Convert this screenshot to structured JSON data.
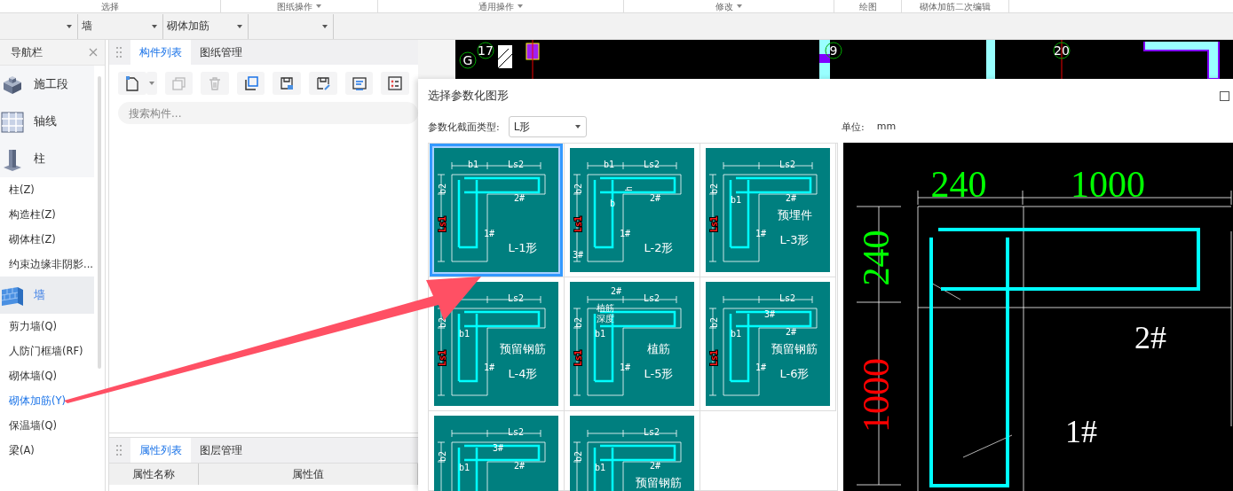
{
  "ribbon_groups": [
    {
      "label": "选择",
      "dropdown": false
    },
    {
      "label": "图纸操作",
      "dropdown": true
    },
    {
      "label": "通用操作",
      "dropdown": true
    },
    {
      "label": "修改",
      "dropdown": true
    },
    {
      "label": "绘图",
      "dropdown": false
    },
    {
      "label": "砌体加筋二次编辑",
      "dropdown": false
    }
  ],
  "toolbar_selects": [
    {
      "kind": "select"
    },
    {
      "kind": "select",
      "value": "墙"
    },
    {
      "kind": "select",
      "value": "砌体加筋"
    },
    {
      "kind": "select"
    }
  ],
  "nav": {
    "title": "导航栏",
    "items": [
      {
        "kind": "category",
        "label": "施工段",
        "selected": false
      },
      {
        "kind": "category",
        "label": "轴线",
        "selected": false
      },
      {
        "kind": "category",
        "label": "柱",
        "selected": false
      },
      {
        "kind": "item",
        "label": "柱(Z)",
        "selected": false
      },
      {
        "kind": "item",
        "label": "构造柱(Z)",
        "selected": false
      },
      {
        "kind": "item",
        "label": "砌体柱(Z)",
        "selected": false
      },
      {
        "kind": "item",
        "label": "约束边缘非阴影...",
        "selected": false
      },
      {
        "kind": "category",
        "label": "墙",
        "selected": true
      },
      {
        "kind": "item",
        "label": "剪力墙(Q)",
        "selected": false
      },
      {
        "kind": "item",
        "label": "人防门框墙(RF)",
        "selected": false
      },
      {
        "kind": "item",
        "label": "砌体墙(Q)",
        "selected": false
      },
      {
        "kind": "item",
        "label": "砌体加筋(Y)",
        "selected": true
      },
      {
        "kind": "item",
        "label": "保温墙(Q)",
        "selected": false
      },
      {
        "kind": "item",
        "label": "梁(A)",
        "selected": false
      }
    ]
  },
  "component_panel": {
    "tabs": [
      {
        "label": "构件列表",
        "selected": true
      },
      {
        "label": "图纸管理",
        "selected": false
      }
    ],
    "tools": [
      {
        "kind": "new",
        "disabled": false
      },
      {
        "kind": "copy",
        "disabled": true
      },
      {
        "kind": "delete",
        "disabled": true
      },
      {
        "kind": "layers",
        "disabled": false
      },
      {
        "kind": "save",
        "disabled": false
      },
      {
        "kind": "edit",
        "disabled": false
      },
      {
        "kind": "text",
        "disabled": false
      },
      {
        "kind": "list",
        "disabled": false
      }
    ],
    "search": {
      "placeholder": "搜索构件..."
    }
  },
  "property_panel": {
    "tabs": [
      {
        "label": "属性列表",
        "selected": true
      },
      {
        "label": "图层管理",
        "selected": false
      }
    ],
    "columns": [
      "属性名称",
      "属性值"
    ]
  },
  "cad": {
    "axes": [
      {
        "label": "G"
      },
      {
        "label": "17"
      },
      {
        "label": "9"
      },
      {
        "label": "20"
      }
    ]
  },
  "dialog": {
    "title": "选择参数化图形",
    "type_label": "参数化截面类型:",
    "type_value": "L形",
    "unit_label": "单位:",
    "unit": "mm",
    "shapes": [
      {
        "kind": "plain",
        "selected": true,
        "labels": [
          {
            "kind": "b1",
            "text": "b1"
          },
          {
            "kind": "ls2",
            "text": "Ls2"
          },
          {
            "kind": "b2",
            "text": "b2"
          },
          {
            "kind": "ls1",
            "text": "Ls1"
          },
          {
            "kind": "bar2",
            "text": "2#"
          },
          {
            "kind": "bar1",
            "text": "1#"
          }
        ],
        "caption": [
          "L-1形"
        ]
      },
      {
        "kind": "plain",
        "selected": false,
        "labels": [
          {
            "kind": "b1",
            "text": "b1"
          },
          {
            "kind": "ls2",
            "text": "Ls2"
          },
          {
            "kind": "b2",
            "text": "b2"
          },
          {
            "kind": "h",
            "text": "h"
          },
          {
            "kind": "b",
            "text": "b"
          },
          {
            "kind": "ls1",
            "text": "Ls1"
          },
          {
            "kind": "bar2",
            "text": "2#"
          },
          {
            "kind": "bar1",
            "text": "1#"
          },
          {
            "kind": "bar3",
            "text": "3#"
          }
        ],
        "caption": [
          "L-2形"
        ]
      },
      {
        "kind": "titled",
        "selected": false,
        "labels": [
          {
            "kind": "ls2",
            "text": "Ls2"
          },
          {
            "kind": "b2",
            "text": "b2"
          },
          {
            "kind": "b1low",
            "text": "b1"
          },
          {
            "kind": "ls1",
            "text": "Ls1"
          },
          {
            "kind": "bar2",
            "text": "2#"
          },
          {
            "kind": "bar1",
            "text": "1#"
          }
        ],
        "caption": [
          "预埋件",
          "L-3形"
        ]
      },
      {
        "kind": "titled",
        "selected": false,
        "labels": [
          {
            "kind": "ls2",
            "text": "Ls2"
          },
          {
            "kind": "b2",
            "text": "b2"
          },
          {
            "kind": "b1low",
            "text": "b1"
          },
          {
            "kind": "ls1",
            "text": "Ls1"
          },
          {
            "kind": "bar1",
            "text": "1#"
          }
        ],
        "caption": [
          "预留钢筋",
          "L-4形"
        ]
      },
      {
        "kind": "titled",
        "selected": false,
        "labels": [
          {
            "kind": "bartop",
            "text": "2#"
          },
          {
            "kind": "ls2",
            "text": "Ls2"
          },
          {
            "kind": "note1",
            "text": "植筋"
          },
          {
            "kind": "note2",
            "text": "深度"
          },
          {
            "kind": "b2",
            "text": "b2"
          },
          {
            "kind": "b1low",
            "text": "b1"
          },
          {
            "kind": "ls1",
            "text": "Ls1"
          },
          {
            "kind": "bar1",
            "text": "1#"
          }
        ],
        "caption": [
          "植筋",
          "L-5形"
        ]
      },
      {
        "kind": "titled",
        "selected": false,
        "labels": [
          {
            "kind": "ls2",
            "text": "Ls2"
          },
          {
            "kind": "b2",
            "text": "b2"
          },
          {
            "kind": "bar3high",
            "text": "3#"
          },
          {
            "kind": "b1low",
            "text": "b1"
          },
          {
            "kind": "bar2",
            "text": "2#"
          },
          {
            "kind": "ls1",
            "text": "Ls1"
          },
          {
            "kind": "bar1",
            "text": "1#"
          }
        ],
        "caption": [
          "预留钢筋",
          "L-6形"
        ]
      },
      {
        "kind": "titled",
        "selected": false,
        "labels": [
          {
            "kind": "ls2",
            "text": "Ls2"
          },
          {
            "kind": "b2",
            "text": "b2"
          },
          {
            "kind": "bar3high",
            "text": "3#"
          },
          {
            "kind": "b1low",
            "text": "b1"
          },
          {
            "kind": "bar2",
            "text": "2#"
          }
        ]
      },
      {
        "kind": "titled",
        "selected": false,
        "labels": [
          {
            "kind": "ls2",
            "text": "Ls2"
          },
          {
            "kind": "b2",
            "text": "b2"
          },
          {
            "kind": "b1low",
            "text": "b1"
          },
          {
            "kind": "bar2",
            "text": "2#"
          }
        ],
        "caption": [
          "预留钢筋"
        ]
      }
    ],
    "preview": {
      "dims": [
        {
          "kind": "top-short",
          "text": "240",
          "color": "#00ff00"
        },
        {
          "kind": "top-long",
          "text": "1000",
          "color": "#00ff00"
        },
        {
          "kind": "side-short",
          "text": "240",
          "color": "#00ff00"
        },
        {
          "kind": "side-long",
          "text": "1000",
          "color": "#ff0000"
        }
      ],
      "bars": [
        {
          "kind": "bar2",
          "text": "2#"
        },
        {
          "kind": "bar1",
          "text": "1#"
        }
      ]
    }
  }
}
